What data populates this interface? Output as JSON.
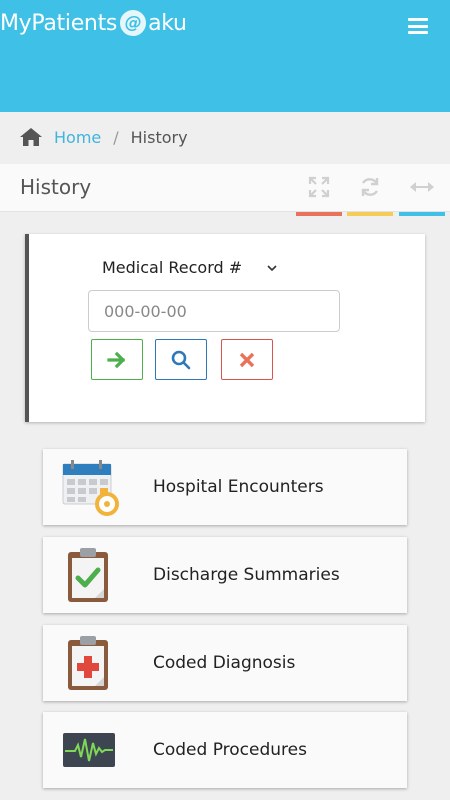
{
  "app": {
    "brand_prefix": "MyPatients",
    "brand_at": "@",
    "brand_suffix": "aku"
  },
  "breadcrumb": {
    "home": "Home",
    "separator": "/",
    "current": "History"
  },
  "page": {
    "title": "History"
  },
  "toolbar": [
    {
      "icon": "expand-icon",
      "accent": "#e8735a"
    },
    {
      "icon": "refresh-icon",
      "accent": "#f5cc55"
    },
    {
      "icon": "horizontal-arrows-icon",
      "accent": "#3fc0e6"
    }
  ],
  "search": {
    "field_select": "Medical Record #",
    "placeholder": "000-00-00",
    "value": ""
  },
  "actions": [
    {
      "icon": "arrow-right-icon",
      "color": "#4cae4c"
    },
    {
      "icon": "search-icon",
      "color": "#2e78b7"
    },
    {
      "icon": "close-icon",
      "color": "#d9534f"
    }
  ],
  "menu": [
    {
      "label": "Hospital Encounters",
      "icon": "calendar-icon"
    },
    {
      "label": "Discharge Summaries",
      "icon": "clipboard-check-icon"
    },
    {
      "label": "Coded Diagnosis",
      "icon": "clipboard-medical-icon"
    },
    {
      "label": "Coded Procedures",
      "icon": "heartbeat-monitor-icon"
    }
  ]
}
